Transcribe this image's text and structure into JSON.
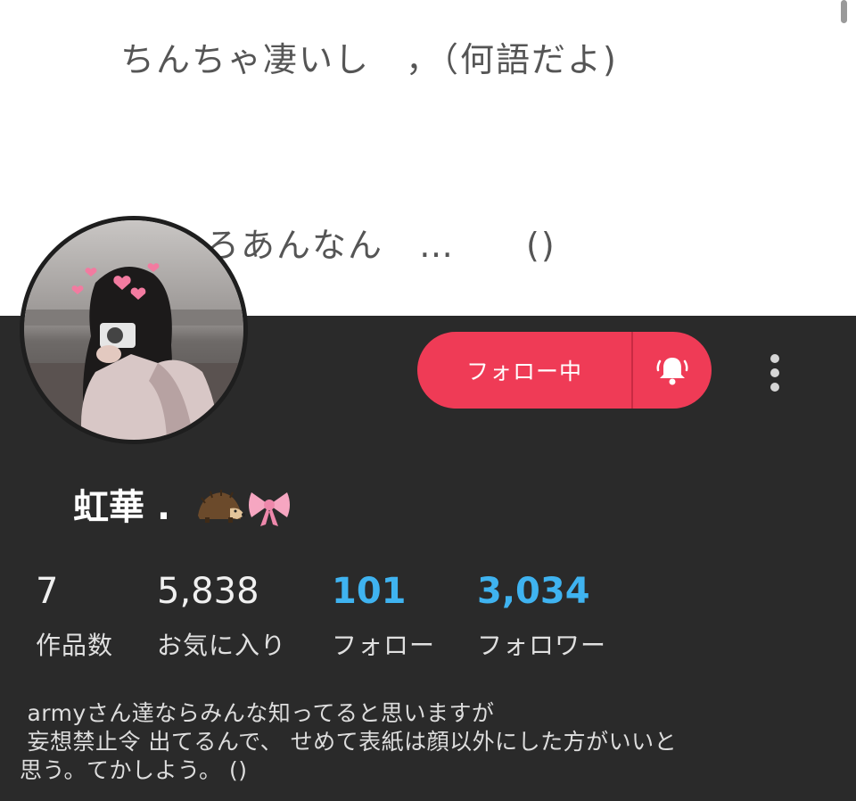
{
  "cover": {
    "line1": "ちんちゃ凄いし　，（何語だよ)",
    "line2": "やろあんなん　…　　()"
  },
  "profile": {
    "follow_label": "フォロー中",
    "name": "虹華 .",
    "stats": [
      {
        "value": "7",
        "label": "作品数"
      },
      {
        "value": "5,838",
        "label": "お気に入り"
      },
      {
        "value": "101",
        "label": "フォロー"
      },
      {
        "value": "3,034",
        "label": "フォロワー"
      }
    ],
    "bio_lines": [
      " armyさん達ならみんな知ってると思いますが",
      " 妄想禁止令 出てるんで、 せめて表紙は顔以外にした方がいいと",
      "思う。てかしよう。 ()"
    ]
  },
  "colors": {
    "panel_bg": "#2a2a2a",
    "follow_button": "#ef3b56",
    "stat_blue": "#3fb3f0"
  },
  "icons": [
    "bell-icon",
    "more-vertical-icon",
    "hedgehog-emoji",
    "ribbon-emoji"
  ]
}
